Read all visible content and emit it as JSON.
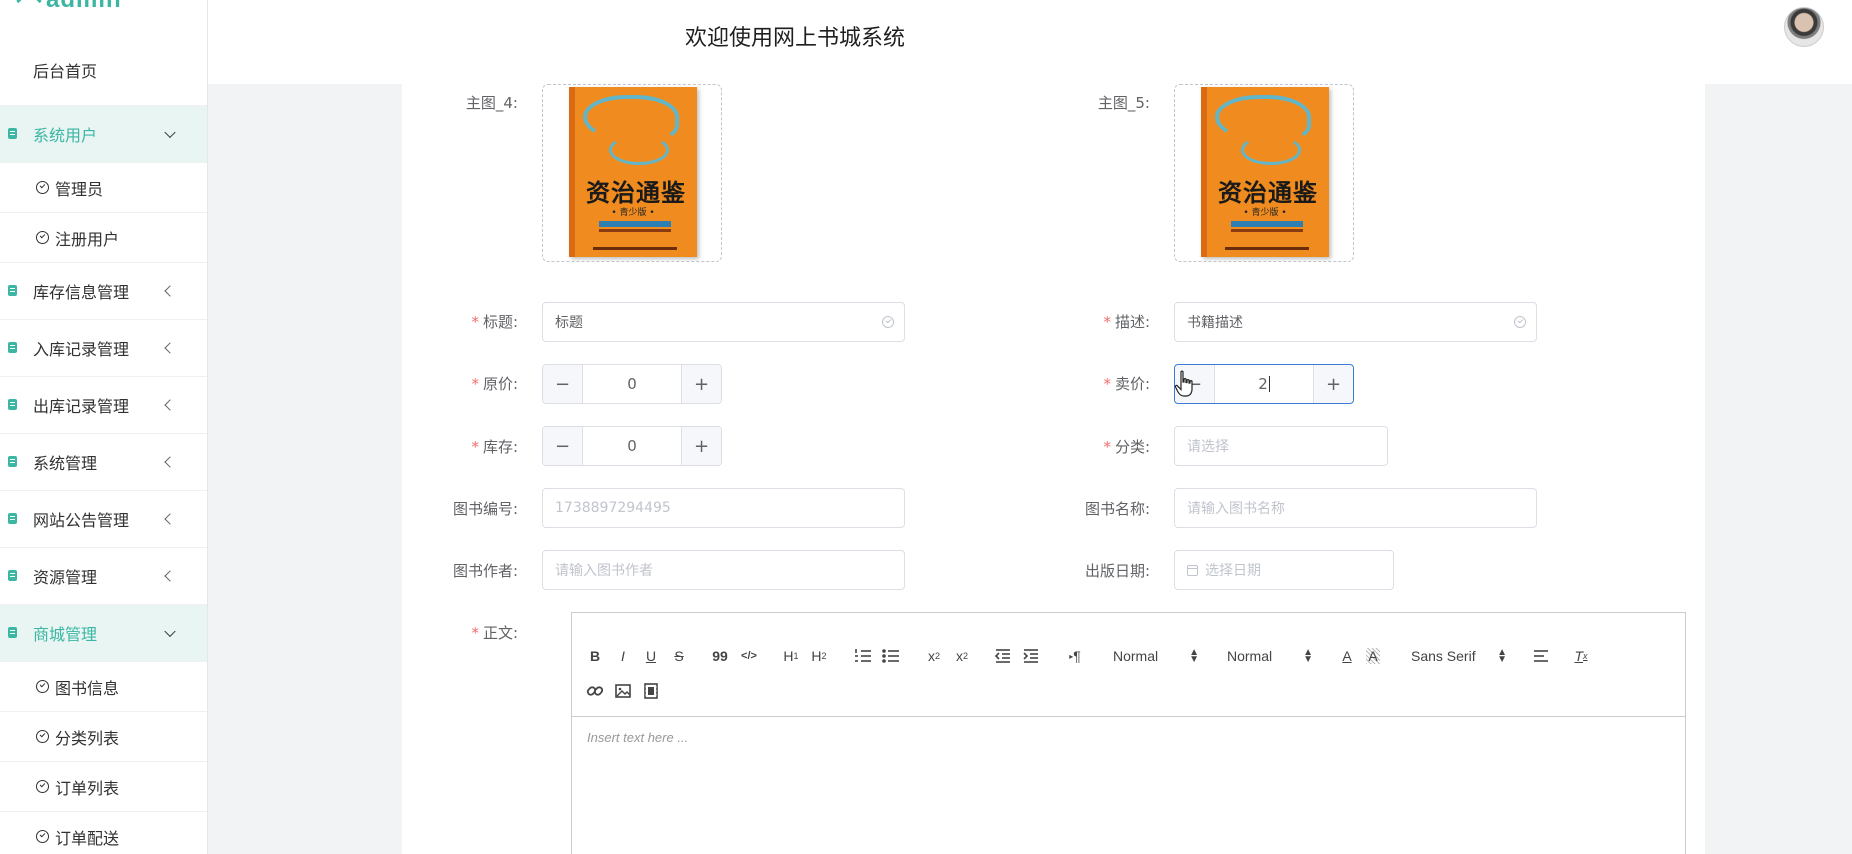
{
  "brand": {
    "name": "admin"
  },
  "header": {
    "title": "欢迎使用网上书城系统"
  },
  "sidebar": {
    "home": "后台首页",
    "groups": [
      {
        "label": "系统用户",
        "children": [
          "管理员",
          "注册用户"
        ]
      },
      {
        "label": "库存信息管理"
      },
      {
        "label": "入库记录管理"
      },
      {
        "label": "出库记录管理"
      },
      {
        "label": "系统管理"
      },
      {
        "label": "网站公告管理"
      },
      {
        "label": "资源管理"
      },
      {
        "label": "商城管理",
        "children": [
          "图书信息",
          "分类列表",
          "订单列表",
          "订单配送"
        ]
      }
    ]
  },
  "form": {
    "main_image_4": {
      "label": "主图_4:",
      "cover_title": "资治通鉴",
      "cover_edition": "• 青少版 •"
    },
    "main_image_5": {
      "label": "主图_5:",
      "cover_title": "资治通鉴",
      "cover_edition": "• 青少版 •"
    },
    "title": {
      "label": "标题:",
      "value": "标题"
    },
    "description": {
      "label": "描述:",
      "value": "书籍描述"
    },
    "original_price": {
      "label": "原价:",
      "value": "0"
    },
    "sale_price": {
      "label": "卖价:",
      "value": "2"
    },
    "stock": {
      "label": "库存:",
      "value": "0"
    },
    "category": {
      "label": "分类:",
      "placeholder": "请选择"
    },
    "book_no": {
      "label": "图书编号:",
      "value": "1738897294495"
    },
    "book_name": {
      "label": "图书名称:",
      "placeholder": "请输入图书名称"
    },
    "book_author": {
      "label": "图书作者:",
      "placeholder": "请输入图书作者"
    },
    "publish_date": {
      "label": "出版日期:",
      "placeholder": "选择日期"
    },
    "body": {
      "label": "正文:"
    },
    "required_mark": "*",
    "minus": "−",
    "plus": "+"
  },
  "editor": {
    "toolbar": {
      "bold": "B",
      "italic": "I",
      "underline": "U",
      "strike": "S",
      "blockquote": "99",
      "code": "</>",
      "h1": "H",
      "h1_sub": "1",
      "h2": "H",
      "h2_sub": "2",
      "sub": "x",
      "sub_mark": "2",
      "sup": "x",
      "sup_mark": "2",
      "size": "Normal",
      "header": "Normal",
      "font": "Sans Serif",
      "direction": "¶",
      "clean": "T"
    },
    "placeholder": "Insert text here ..."
  }
}
